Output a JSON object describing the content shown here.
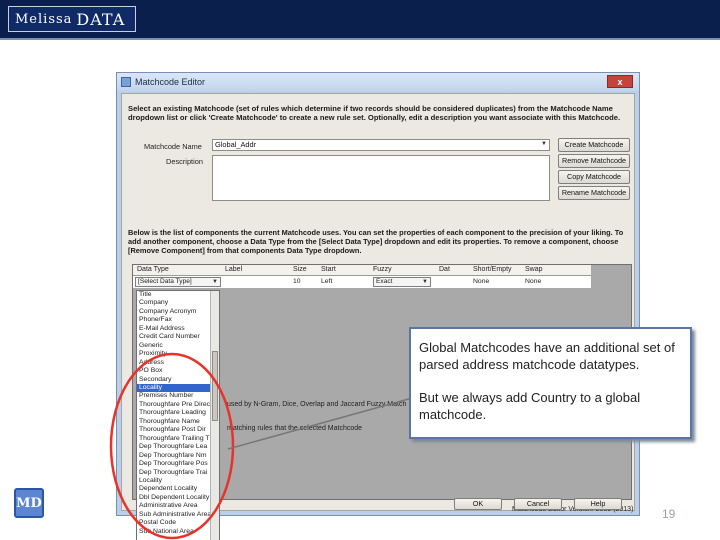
{
  "header": {
    "logo_first": "Melissa",
    "logo_second": "DATA"
  },
  "emblem": {
    "text": "MD"
  },
  "page_number": "19",
  "window": {
    "title": "Matchcode Editor",
    "close_label": "x",
    "instructions": "Select an existing Matchcode (set of rules which determine if two records should be considered duplicates) from the Matchcode Name dropdown list or click 'Create Matchcode' to create a new rule set. Optionally, edit a description you want associate with this Matchcode.",
    "matchcode_name_label": "Matchcode Name",
    "matchcode_name_value": "Global_Addr",
    "description_label": "Description",
    "description_value": "",
    "buttons": {
      "create": "Create Matchcode",
      "remove": "Remove Matchcode",
      "copy": "Copy Matchcode",
      "rename": "Rename Matchcode",
      "ok": "OK",
      "cancel": "Cancel",
      "help": "Help"
    },
    "component_instructions": "Below is the list of components the current Matchcode uses. You can set the properties of each component to the precision of your liking. To add another component, choose a Data Type from the [Select Data Type] dropdown and edit its properties. To remove a component, choose [Remove Component] from that components Data Type dropdown.",
    "grid": {
      "columns": [
        "Data Type",
        "Label",
        "Size",
        "Start",
        "Fuzzy",
        "Dat",
        "Short/Empty",
        "Swap"
      ],
      "row": {
        "data_type": "[Select Data Type]",
        "size": "10",
        "start": "Left",
        "fuzzy": "Exact",
        "short_empty": "None",
        "swap": "None"
      }
    },
    "data_type_options": [
      "Title",
      "Company",
      "Company Acronym",
      "Phone/Fax",
      "E-Mail Address",
      "Credit Card Number",
      "Generic",
      "Proximity",
      "Address",
      "PO Box",
      "Secondary",
      "Locality",
      "Premises Number",
      "Thoroughfare Pre Direct",
      "Thoroughfare Leading",
      "Thoroughfare Name",
      "Thoroughfare Post Dir",
      "Thoroughfare Trailing T",
      "Dep Thoroughfare Lea",
      "Dep Thoroughfare Nm",
      "Dep Thoroughfare Pos",
      "Dep Thoroughfare Trai",
      "Locality",
      "Dependent Locality",
      "Dbl Dependent Locality",
      "Administrative Area",
      "Sub Administrative Area",
      "Postal Code",
      "Sub National Area"
    ],
    "selected_option_index": 11,
    "partial_text_1": "used by N-Gram, Dice, Overlap and Jaccard Fuzzy Match",
    "partial_text_2": "matching rules that the selected Matchcode",
    "version": "Matchcode Editor Version: 2009 (2013)"
  },
  "callout": {
    "paragraph_1": "Global Matchcodes have an additional set of parsed address matchcode datatypes.",
    "paragraph_2": "But we always add Country to a global matchcode."
  },
  "colors": {
    "header_bar": "#0b1f4d",
    "callout_border": "#5876a8",
    "highlight_ellipse": "#e8332b",
    "selection": "#3366cc"
  }
}
